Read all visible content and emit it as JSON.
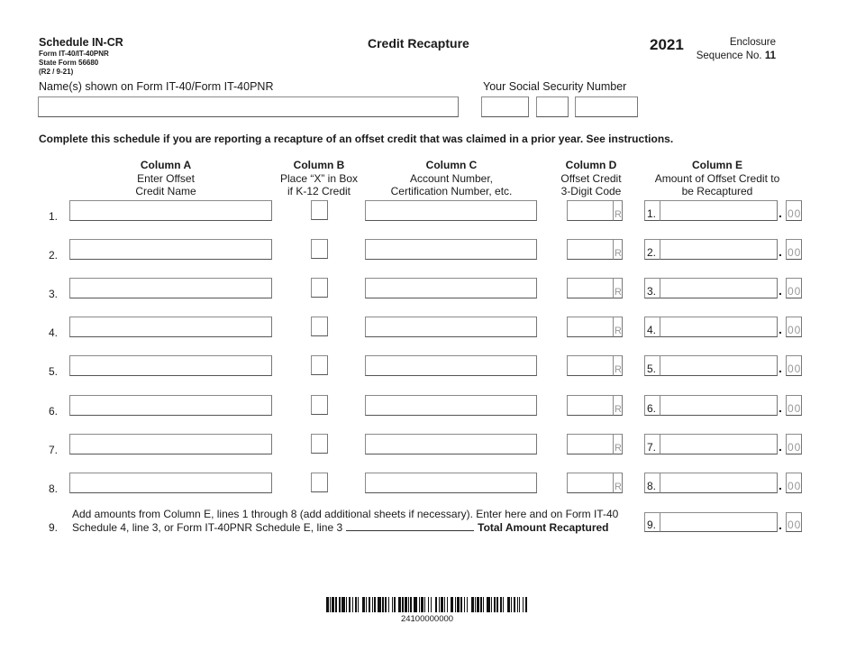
{
  "header": {
    "schedule": "Schedule IN-CR",
    "form": "Form IT-40/IT-40PNR",
    "state_form": "State Form 56680",
    "revision": "(R2 / 9-21)",
    "title": "Credit Recapture",
    "year": "2021",
    "enclosure_label": "Enclosure",
    "sequence_label": "Sequence No.",
    "sequence_no": "11"
  },
  "taxpayer": {
    "name_label": "Name(s) shown on Form IT-40/Form IT-40PNR",
    "name_value": "",
    "ssn_label": "Your Social Security Number",
    "ssn_parts": [
      "",
      "",
      ""
    ]
  },
  "instructions": "Complete this schedule if you are reporting a recapture of an offset credit that was claimed in a prior year. See instructions.",
  "columns": {
    "a": {
      "title": "Column A",
      "line1": "Enter Offset",
      "line2": "Credit Name"
    },
    "b": {
      "title": "Column B",
      "line1": "Place “X” in Box",
      "line2": "if K-12 Credit"
    },
    "c": {
      "title": "Column C",
      "line1": "Account Number,",
      "line2": "Certification Number, etc."
    },
    "d": {
      "title": "Column D",
      "line1": "Offset Credit",
      "line2": "3-Digit Code"
    },
    "e": {
      "title": "Column E",
      "line1": "Amount of Offset Credit to",
      "line2": "be Recaptured"
    }
  },
  "code_suffix": "R",
  "cents": "00",
  "decimal": ".",
  "rows": [
    {
      "num": "1.",
      "credit_name": "",
      "k12": false,
      "account": "",
      "code": "",
      "amount": ""
    },
    {
      "num": "2.",
      "credit_name": "",
      "k12": false,
      "account": "",
      "code": "",
      "amount": ""
    },
    {
      "num": "3.",
      "credit_name": "",
      "k12": false,
      "account": "",
      "code": "",
      "amount": ""
    },
    {
      "num": "4.",
      "credit_name": "",
      "k12": false,
      "account": "",
      "code": "",
      "amount": ""
    },
    {
      "num": "5.",
      "credit_name": "",
      "k12": false,
      "account": "",
      "code": "",
      "amount": ""
    },
    {
      "num": "6.",
      "credit_name": "",
      "k12": false,
      "account": "",
      "code": "",
      "amount": ""
    },
    {
      "num": "7.",
      "credit_name": "",
      "k12": false,
      "account": "",
      "code": "",
      "amount": ""
    },
    {
      "num": "8.",
      "credit_name": "",
      "k12": false,
      "account": "",
      "code": "",
      "amount": ""
    }
  ],
  "line9": {
    "num": "9.",
    "text1": "Add amounts from Column E, lines 1 through 8 (add additional sheets if necessary). Enter here and on Form IT-40",
    "text2": "Schedule 4, line 3, or Form IT-40PNR Schedule E, line 3",
    "total_label": "Total Amount Recaptured",
    "box_label": "9.",
    "amount": ""
  },
  "barcode_number": "24100000000"
}
